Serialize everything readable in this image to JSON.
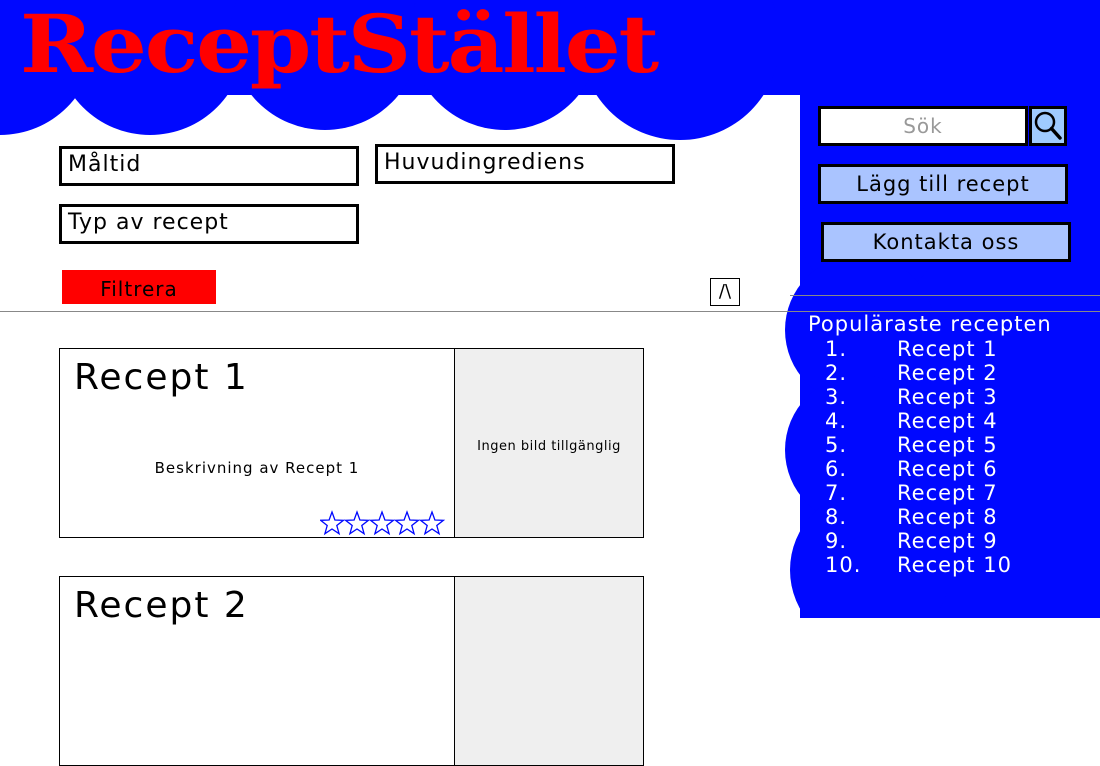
{
  "header": {
    "logo_text": "ReceptStället"
  },
  "filters": {
    "meal_label": "Måltid",
    "main_ingredient_label": "Huvudingrediens",
    "recipe_type_label": "Typ av recept",
    "filter_button": "Filtrera",
    "collapse_button": "/\\"
  },
  "search": {
    "placeholder": "Sök"
  },
  "sidebar": {
    "add_recipe_button": "Lägg till recept",
    "contact_button": "Kontakta oss",
    "popular_title": "Populäraste recepten",
    "popular": [
      {
        "num": "1.",
        "name": "Recept 1"
      },
      {
        "num": "2.",
        "name": "Recept 2"
      },
      {
        "num": "3.",
        "name": "Recept 3"
      },
      {
        "num": "4.",
        "name": "Recept 4"
      },
      {
        "num": "5.",
        "name": "Recept 5"
      },
      {
        "num": "6.",
        "name": "Recept 6"
      },
      {
        "num": "7.",
        "name": "Recept 7"
      },
      {
        "num": "8.",
        "name": "Recept 8"
      },
      {
        "num": "9.",
        "name": "Recept 9"
      },
      {
        "num": "10.",
        "name": "Recept 10"
      }
    ]
  },
  "recipes": [
    {
      "title": "Recept 1",
      "description": "Beskrivning av Recept 1",
      "image_text": "Ingen bild tillgänglig",
      "rating": 0,
      "rating_max": 5
    },
    {
      "title": "Recept 2"
    }
  ],
  "colors": {
    "brand_blue": "#0008ff",
    "logo_red": "#ff0000",
    "button_blue": "#aac4ff",
    "search_blue": "#9fcbff"
  },
  "icons": {
    "search": "search-icon",
    "star": "star-icon"
  }
}
